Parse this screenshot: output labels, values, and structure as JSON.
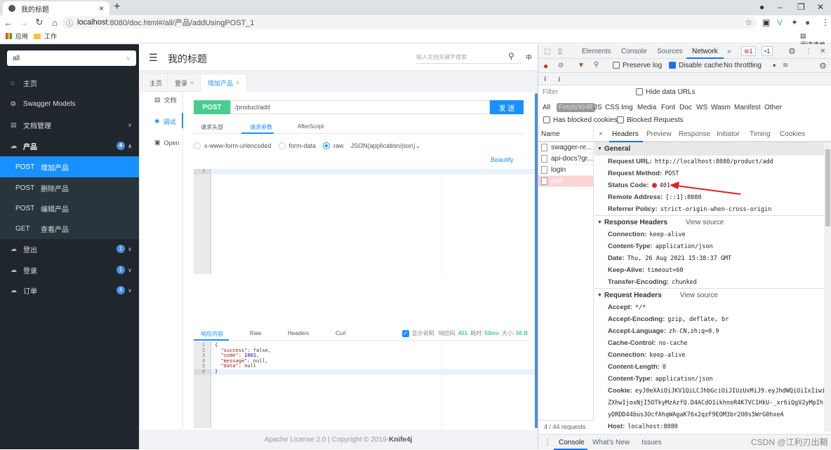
{
  "browser": {
    "tab_title": "我的标题",
    "url_prefix": "localhost",
    "url_rest": ":8080/doc.html#/all/产品/addUsingPOST_1",
    "bookmarks": [
      "应用",
      "工作"
    ],
    "reading_list": "阅读清单"
  },
  "sidebar": {
    "group_select": "all",
    "items": [
      {
        "label": "主页",
        "icon": "home-icon"
      },
      {
        "label": "Swagger Models",
        "icon": "models-icon"
      },
      {
        "label": "文档管理",
        "icon": "doc-manage-icon",
        "arrow": "⌄"
      },
      {
        "label": "产品",
        "icon": "cloud-icon",
        "badge": "4",
        "arrow": "˄"
      }
    ],
    "sub_items": [
      {
        "method": "POST",
        "label": "增加产品"
      },
      {
        "method": "POST",
        "label": "删除产品"
      },
      {
        "method": "POST",
        "label": "编辑产品"
      },
      {
        "method": "GET",
        "label": "查看产品"
      }
    ],
    "more_items": [
      {
        "label": "登出",
        "badge": "1"
      },
      {
        "label": "登录",
        "badge": "1"
      },
      {
        "label": "订单",
        "badge": "4"
      }
    ]
  },
  "header": {
    "title": "我的标题",
    "search_placeholder": "输入文档关键字搜索",
    "lang": "中"
  },
  "doc_tabs": [
    {
      "label": "主页"
    },
    {
      "label": "登录",
      "close": "×"
    },
    {
      "label": "增加产品",
      "close": "×"
    }
  ],
  "left_tabs": [
    {
      "label": "文档"
    },
    {
      "label": "调试"
    },
    {
      "label": "Open"
    }
  ],
  "request": {
    "method": "POST",
    "path": "/product/add",
    "send": "发 送",
    "param_tabs": [
      "请求头部",
      "请求参数",
      "AfterScript"
    ],
    "content_types": [
      "x-www-form-urlencoded",
      "form-data",
      "raw"
    ],
    "raw_type": "JSON(application/json)",
    "beautify": "Beautify",
    "editor_lines": [
      "1"
    ]
  },
  "response": {
    "tabs": [
      "响应内容",
      "Raw",
      "Headers",
      "Curl"
    ],
    "show_desc": "显示说明",
    "code_label": "响应码:",
    "code": "401",
    "time_label": "耗时:",
    "time": "50ms",
    "size_label": "大小:",
    "size": "56 B",
    "line_numbers": [
      "1",
      "2",
      "3",
      "4",
      "5",
      "6"
    ],
    "body": {
      "open": "{",
      "success_key": "\"success\"",
      "success_val": ": false,",
      "code_key": "\"code\"",
      "code_val": "1001",
      "message_key": "\"message\"",
      "message_val": ": null,",
      "data_key": "\"data\"",
      "data_val": ": null",
      "close": "}"
    }
  },
  "footer": {
    "text": "Apache License 2.0 | Copyright © 2019-",
    "brand": "Knife4j"
  },
  "devtools": {
    "tabs": [
      "Elements",
      "Console",
      "Sources",
      "Network"
    ],
    "more": "»",
    "errors": "1",
    "messages": "1",
    "preserve_log": "Preserve log",
    "disable_cache": "Disable cache",
    "throttling": "No throttling",
    "filter_placeholder": "Filter",
    "hide_data_urls": "Hide data URLs",
    "filter_types": [
      "All",
      "Fetch/XHR",
      "JS",
      "CSS",
      "Img",
      "Media",
      "Font",
      "Doc",
      "WS",
      "Wasm",
      "Manifest",
      "Other"
    ],
    "has_blocked_cookies": "Has blocked cookies",
    "blocked_requests": "Blocked Requests",
    "name_header": "Name",
    "requests": [
      "swagger-re...",
      "api-docs?gr...",
      "login",
      "add"
    ],
    "request_count": "4 / 44 requests",
    "detail_tabs": [
      "Headers",
      "Preview",
      "Response",
      "Initiator",
      "Timing",
      "Cookies"
    ],
    "general": {
      "title": "General",
      "rows": [
        {
          "k": "Request URL:",
          "v": "http://localhost:8080/product/add"
        },
        {
          "k": "Request Method:",
          "v": "POST"
        },
        {
          "k": "Status Code:",
          "v": "401"
        },
        {
          "k": "Remote Address:",
          "v": "[::1]:8080"
        },
        {
          "k": "Referrer Policy:",
          "v": "strict-origin-when-cross-origin"
        }
      ]
    },
    "response_headers": {
      "title": "Response Headers",
      "view_source": "View source",
      "rows": [
        {
          "k": "Connection:",
          "v": "keep-alive"
        },
        {
          "k": "Content-Type:",
          "v": "application/json"
        },
        {
          "k": "Date:",
          "v": "Thu, 26 Aug 2021 15:38:37 GMT"
        },
        {
          "k": "Keep-Alive:",
          "v": "timeout=60"
        },
        {
          "k": "Transfer-Encoding:",
          "v": "chunked"
        }
      ]
    },
    "request_headers": {
      "title": "Request Headers",
      "view_source": "View source",
      "rows": [
        {
          "k": "Accept:",
          "v": "*/*"
        },
        {
          "k": "Accept-Encoding:",
          "v": "gzip, deflate, br"
        },
        {
          "k": "Accept-Language:",
          "v": "zh-CN,zh;q=0.9"
        },
        {
          "k": "Cache-Control:",
          "v": "no-cache"
        },
        {
          "k": "Connection:",
          "v": "keep-alive"
        },
        {
          "k": "Content-Length:",
          "v": "0"
        },
        {
          "k": "Content-Type:",
          "v": "application/json"
        },
        {
          "k": "Cookie:",
          "v": "eyJ0eXAiOiJKV1QiLCJhbGciOiJIUzUxMiJ9.eyJhdWQiOiIxIiwi"
        },
        {
          "k": "",
          "v": "ZXhwIjoxNjI5OTkyMzAzfQ.D4ACdO1ikhnoR4K7VC1HkU-_xr6iQgV2yMpIh"
        },
        {
          "k": "",
          "v": "yDRDD44bus3OcfAhqWAgaK76x2qzF9EOM3br2O0s5WrG0hxeA"
        },
        {
          "k": "Host:",
          "v": "localhost:8080"
        }
      ]
    },
    "drawer_tabs": [
      "Console",
      "What's New",
      "Issues"
    ]
  },
  "watermark": "CSDN @江利刃出鞘",
  "colors": {
    "accent": "#1890ff",
    "post": "#49cc90",
    "sidebar": "#1f272d",
    "error": "#d93025"
  }
}
